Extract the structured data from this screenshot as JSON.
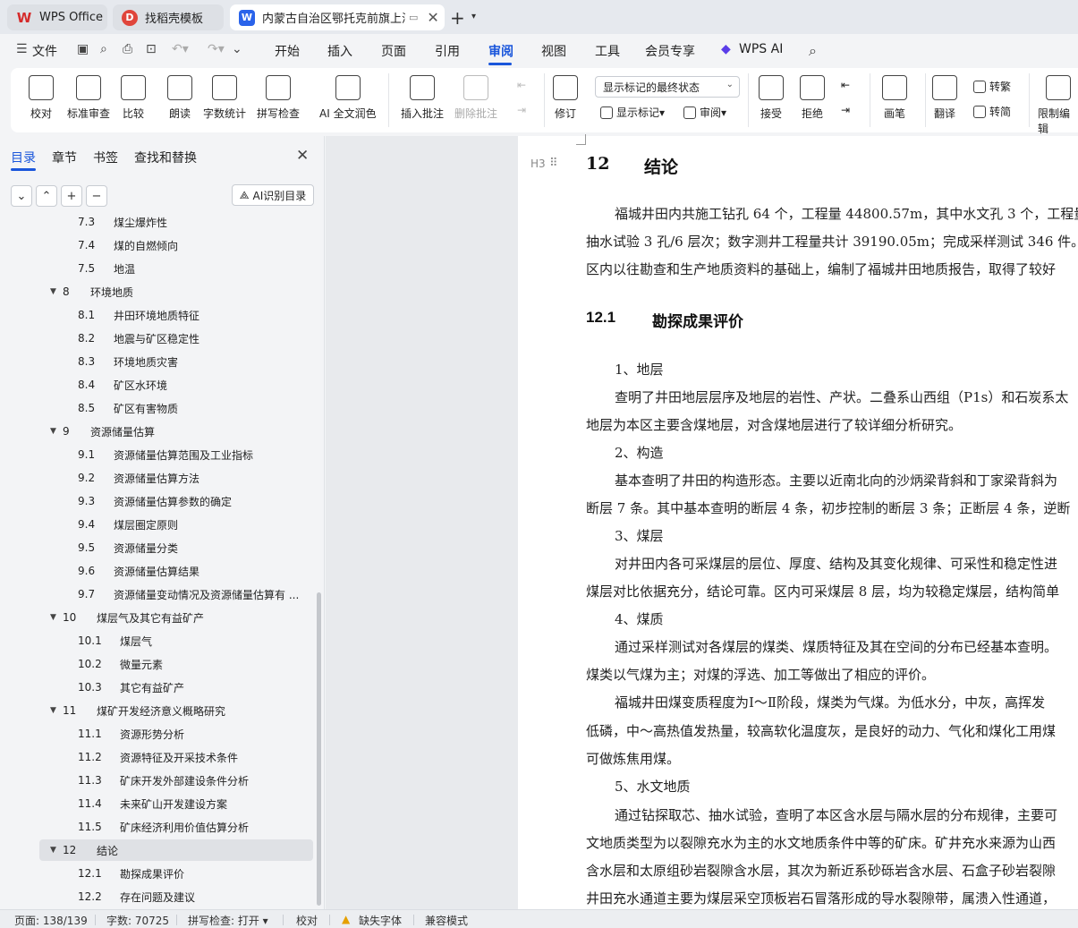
{
  "tabs": {
    "wps": "WPS Office",
    "template": "找稻壳模板",
    "document": "内蒙古自治区鄂托克前旗上海"
  },
  "menu": {
    "file": "文件",
    "items": [
      "开始",
      "插入",
      "页面",
      "引用",
      "审阅",
      "视图",
      "工具",
      "会员专享"
    ],
    "active": "审阅",
    "wps_ai": "WPS AI"
  },
  "ribbon": {
    "proofread": "校对",
    "standard_review": "标准审查",
    "compare": "比较",
    "read_aloud": "朗读",
    "word_count": "字数统计",
    "spell_check": "拼写检查",
    "ai_polish": "AI 全文润色",
    "insert_comment": "插入批注",
    "delete_comment": "删除批注",
    "track_changes": "修订",
    "markup_select": "显示标记的最终状态",
    "show_markup": "显示标记",
    "review": "审阅",
    "accept": "接受",
    "reject": "拒绝",
    "pen": "画笔",
    "translate": "翻译",
    "to_traditional": "转繁",
    "to_simplified": "转简",
    "restrict_edit": "限制编辑"
  },
  "panel": {
    "tabs": [
      "目录",
      "章节",
      "书签",
      "查找和替换"
    ],
    "ai_toc": "AI识别目录",
    "toc": [
      {
        "num": "7.3",
        "text": "煤尘爆炸性",
        "level": 2
      },
      {
        "num": "7.4",
        "text": "煤的自燃倾向",
        "level": 2
      },
      {
        "num": "7.5",
        "text": "地温",
        "level": 2
      },
      {
        "num": "8",
        "text": "环境地质",
        "level": 1
      },
      {
        "num": "8.1",
        "text": "井田环境地质特征",
        "level": 2
      },
      {
        "num": "8.2",
        "text": "地震与矿区稳定性",
        "level": 2
      },
      {
        "num": "8.3",
        "text": "环境地质灾害",
        "level": 2
      },
      {
        "num": "8.4",
        "text": "矿区水环境",
        "level": 2
      },
      {
        "num": "8.5",
        "text": "矿区有害物质",
        "level": 2
      },
      {
        "num": "9",
        "text": "资源储量估算",
        "level": 1
      },
      {
        "num": "9.1",
        "text": "资源储量估算范围及工业指标",
        "level": 2
      },
      {
        "num": "9.2",
        "text": "资源储量估算方法",
        "level": 2
      },
      {
        "num": "9.3",
        "text": "资源储量估算参数的确定",
        "level": 2
      },
      {
        "num": "9.4",
        "text": "煤层圈定原则",
        "level": 2
      },
      {
        "num": "9.5",
        "text": "资源储量分类",
        "level": 2
      },
      {
        "num": "9.6",
        "text": "资源储量估算结果",
        "level": 2
      },
      {
        "num": "9.7",
        "text": "资源储量变动情况及资源储量估算有 ...",
        "level": 2
      },
      {
        "num": "10",
        "text": "煤层气及其它有益矿产",
        "level": 1
      },
      {
        "num": "10.1",
        "text": "煤层气",
        "level": 2
      },
      {
        "num": "10.2",
        "text": "微量元素",
        "level": 2
      },
      {
        "num": "10.3",
        "text": "其它有益矿产",
        "level": 2
      },
      {
        "num": "11",
        "text": "煤矿开发经济意义概略研究",
        "level": 1
      },
      {
        "num": "11.1",
        "text": "资源形势分析",
        "level": 2
      },
      {
        "num": "11.2",
        "text": "资源特征及开采技术条件",
        "level": 2
      },
      {
        "num": "11.3",
        "text": "矿床开发外部建设条件分析",
        "level": 2
      },
      {
        "num": "11.4",
        "text": "未来矿山开发建设方案",
        "level": 2
      },
      {
        "num": "11.5",
        "text": "矿床经济利用价值估算分析",
        "level": 2
      },
      {
        "num": "12",
        "text": "结论",
        "level": 1,
        "selected": true
      },
      {
        "num": "12.1",
        "text": "勘探成果评价",
        "level": 2
      },
      {
        "num": "12.2",
        "text": "存在问题及建议",
        "level": 2
      }
    ]
  },
  "document": {
    "heading_mark": "H3",
    "h1_num": "12",
    "h1_text": "结论",
    "h2_num": "12.1",
    "h2_text": "勘探成果评价",
    "lines": [
      "福城井田内共施工钻孔 64 个，工程量 44800.57m，其中水文孔 3 个，工程量",
      "抽水试验 3 孔/6 层次；数字测井工程量共计 39190.05m；完成采样测试 346 件。",
      "区内以往勘查和生产地质资料的基础上，编制了福城井田地质报告，取得了较好",
      "1、地层",
      "查明了井田地层层序及地层的岩性、产状。二叠系山西组（P1s）和石炭系太",
      "地层为本区主要含煤地层，对含煤地层进行了较详细分析研究。",
      "2、构造",
      "基本查明了井田的构造形态。主要以近南北向的沙炳梁背斜和丁家梁背斜为",
      "断层 7 条。其中基本查明的断层 4 条，初步控制的断层 3 条；正断层 4 条，逆断",
      "3、煤层",
      "对井田内各可采煤层的层位、厚度、结构及其变化规律、可采性和稳定性进",
      "煤层对比依据充分，结论可靠。区内可采煤层 8 层，均为较稳定煤层，结构简单",
      "4、煤质",
      "通过采样测试对各煤层的煤类、煤质特征及其在空间的分布已经基本查明。",
      "煤类以气煤为主；对煤的浮选、加工等做出了相应的评价。",
      "福城井田煤变质程度为Ⅰ～Ⅱ阶段，煤类为气煤。为低水分，中灰，高挥发",
      "低磷，中～高热值发热量，较高软化温度灰，是良好的动力、气化和煤化工用煤",
      "可做炼焦用煤。",
      "5、水文地质",
      "通过钻探取芯、抽水试验，查明了本区含水层与隔水层的分布规律，主要可",
      "文地质类型为以裂隙充水为主的水文地质条件中等的矿床。矿井充水来源为山西",
      "含水层和太原组砂岩裂隙含水层，其次为新近系砂砾岩含水层、石盒子砂岩裂隙",
      "井田充水通道主要为煤层采空顶板岩石冒落形成的导水裂隙带，属溃入性通道，"
    ]
  },
  "status": {
    "page": "页面: 138/139",
    "words": "字数: 70725",
    "spell": "拼写检查: 打开",
    "proof": "校对",
    "missing_font": "缺失字体",
    "compat": "兼容模式"
  }
}
